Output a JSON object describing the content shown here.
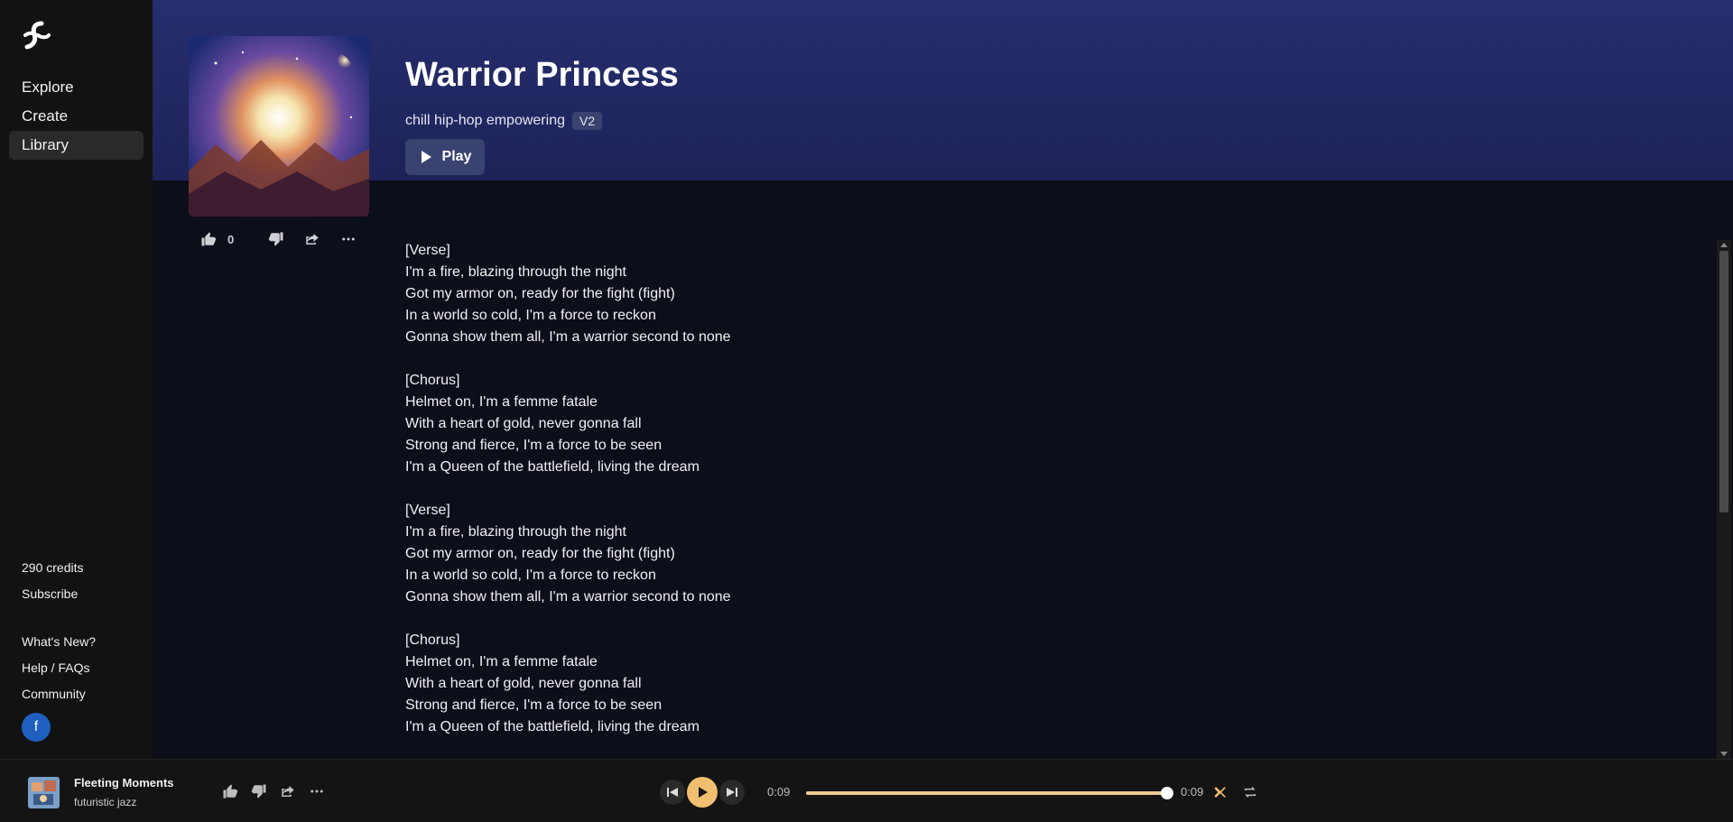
{
  "sidebar": {
    "items": [
      {
        "label": "Explore",
        "active": false
      },
      {
        "label": "Create",
        "active": false
      },
      {
        "label": "Library",
        "active": true
      }
    ],
    "credits": "290 credits",
    "subscribe": "Subscribe",
    "whats_new": "What's New?",
    "help": "Help / FAQs",
    "community": "Community",
    "facebook_letter": "f"
  },
  "song": {
    "title": "Warrior Princess",
    "tags": "chill hip-hop empowering",
    "version": "V2",
    "play_label": "Play",
    "likes": "0"
  },
  "lyrics": [
    "[Verse]",
    "I'm a fire, blazing through the night",
    "Got my armor on, ready for the fight (fight)",
    "In a world so cold, I'm a force to reckon",
    "Gonna show them all, I'm a warrior second to none",
    "",
    "[Chorus]",
    "Helmet on, I'm a femme fatale",
    "With a heart of gold, never gonna fall",
    "Strong and fierce, I'm a force to be seen",
    "I'm a Queen of the battlefield, living the dream",
    "",
    "[Verse]",
    "I'm a fire, blazing through the night",
    "Got my armor on, ready for the fight (fight)",
    "In a world so cold, I'm a force to reckon",
    "Gonna show them all, I'm a warrior second to none",
    "",
    "[Chorus]",
    "Helmet on, I'm a femme fatale",
    "With a heart of gold, never gonna fall",
    "Strong and fierce, I'm a force to be seen",
    "I'm a Queen of the battlefield, living the dream"
  ],
  "player": {
    "track_title": "Fleeting Moments",
    "track_sub": "futuristic jazz",
    "time_elapsed": "0:09",
    "time_total": "0:09",
    "progress_fraction": 1.0
  },
  "colors": {
    "header_band": "#262e6e",
    "accent_play": "#f0c070",
    "progress_fill": "#f0c890"
  }
}
